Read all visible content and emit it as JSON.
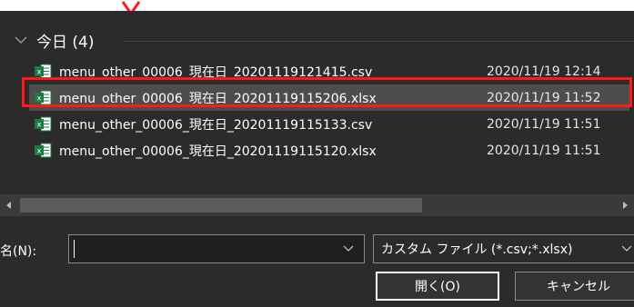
{
  "colors": {
    "background": "#2b2b2b",
    "selected_row": "#4d4d4d",
    "highlight_border": "#ff1a1a",
    "excel_green": "#1d7a45"
  },
  "group": {
    "title": "今日 (4)",
    "icon": "chevron-down-icon"
  },
  "files": [
    {
      "name": "menu_other_00006_現在日_20201119121415.csv",
      "date": "2020/11/19 12:14",
      "selected": false,
      "icon": "excel-file-icon"
    },
    {
      "name": "menu_other_00006_現在日_20201119115206.xlsx",
      "date": "2020/11/19 11:52",
      "selected": true,
      "icon": "excel-file-icon"
    },
    {
      "name": "menu_other_00006_現在日_20201119115133.csv",
      "date": "2020/11/19 11:51",
      "selected": false,
      "icon": "excel-file-icon"
    },
    {
      "name": "menu_other_00006_現在日_20201119115120.xlsx",
      "date": "2020/11/19 11:51",
      "selected": false,
      "icon": "excel-file-icon"
    }
  ],
  "filename": {
    "label": "名(N):",
    "value": ""
  },
  "filter": {
    "selected": "カスタム ファイル (*.csv;*.xlsx)"
  },
  "buttons": {
    "open": "開く(O)",
    "cancel": "キャンセル"
  }
}
